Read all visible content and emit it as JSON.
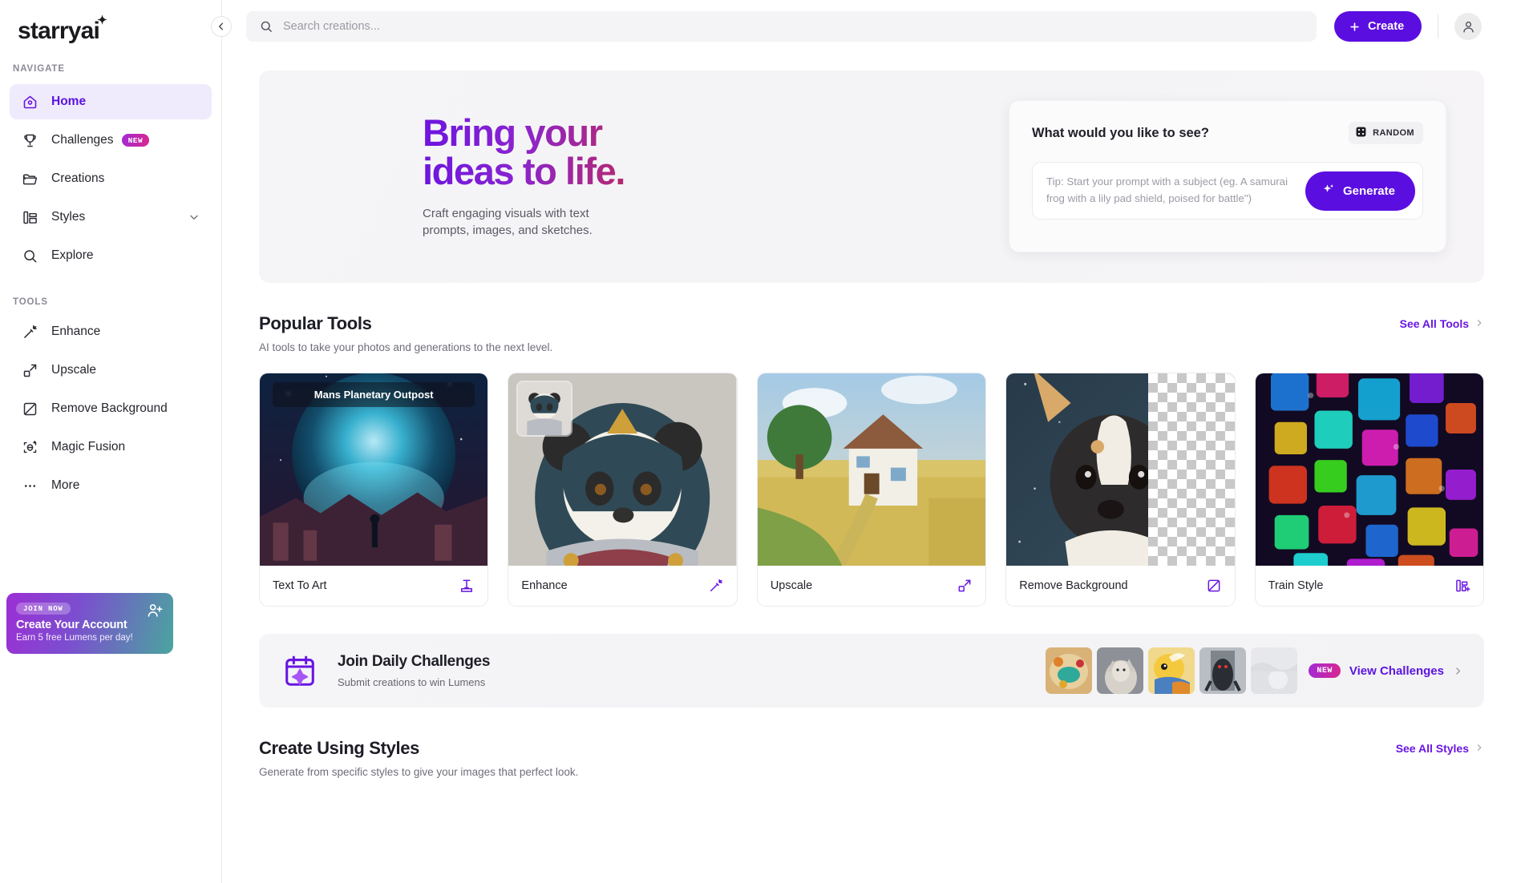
{
  "sidebar": {
    "logo": "starryai",
    "nav_label": "NAVIGATE",
    "tools_label": "TOOLS",
    "nav_items": [
      {
        "label": "Home",
        "icon": "home-icon",
        "active": true
      },
      {
        "label": "Challenges",
        "icon": "trophy-icon",
        "badge": "NEW"
      },
      {
        "label": "Creations",
        "icon": "folder-icon"
      },
      {
        "label": "Styles",
        "icon": "styles-icon",
        "chevron": "chevron-down-icon"
      },
      {
        "label": "Explore",
        "icon": "search-icon"
      }
    ],
    "tool_items": [
      {
        "label": "Enhance",
        "icon": "magic-wand-icon"
      },
      {
        "label": "Upscale",
        "icon": "upscale-arrow-icon"
      },
      {
        "label": "Remove Background",
        "icon": "remove-background-icon"
      },
      {
        "label": "Magic Fusion",
        "icon": "magic-fusion-icon"
      },
      {
        "label": "More",
        "icon": "ellipsis-icon"
      }
    ],
    "promo": {
      "pill": "JOIN NOW",
      "title": "Create Your Account",
      "subtitle": "Earn 5 free Lumens per day!",
      "icon": "add-user-icon",
      "gradient_from": "#9b2fd4",
      "gradient_to": "#4aa59f"
    }
  },
  "topbar": {
    "search_placeholder": "Search creations...",
    "search_value": "",
    "create_label": "Create",
    "accent": "#5b0ee0"
  },
  "hero": {
    "title": "Bring your\nideas to life.",
    "subtitle": "Craft engaging visuals with text\nprompts, images, and sketches.",
    "gradient_from": "#6d14e0",
    "gradient_to": "#b5296f",
    "prompt": {
      "question": "What would you like to see?",
      "random_label": "RANDOM",
      "input_placeholder": "Tip: Start your prompt with a subject (eg. A samurai frog with a lily pad shield, poised for battle\")",
      "input_value": "",
      "generate_label": "Generate"
    }
  },
  "popular_tools": {
    "title": "Popular Tools",
    "subtitle": "AI tools to take your photos and generations to the next level.",
    "see_all": "See All Tools",
    "cards": [
      {
        "label": "Text To Art",
        "icon": "text-to-art-icon",
        "overlay_title": "Mans Planetary Outpost"
      },
      {
        "label": "Enhance",
        "icon": "magic-wand-icon"
      },
      {
        "label": "Upscale",
        "icon": "upscale-arrow-icon"
      },
      {
        "label": "Remove Background",
        "icon": "remove-background-icon"
      },
      {
        "label": "Train Style",
        "icon": "train-style-icon"
      }
    ]
  },
  "challenges_banner": {
    "title": "Join Daily Challenges",
    "subtitle": "Submit creations to win Lumens",
    "icon": "calendar-sparkle-icon",
    "badge": "NEW",
    "cta": "View Challenges"
  },
  "styles_section": {
    "title": "Create Using Styles",
    "subtitle": "Generate from specific styles to give your images that perfect look.",
    "see_all": "See All Styles"
  }
}
